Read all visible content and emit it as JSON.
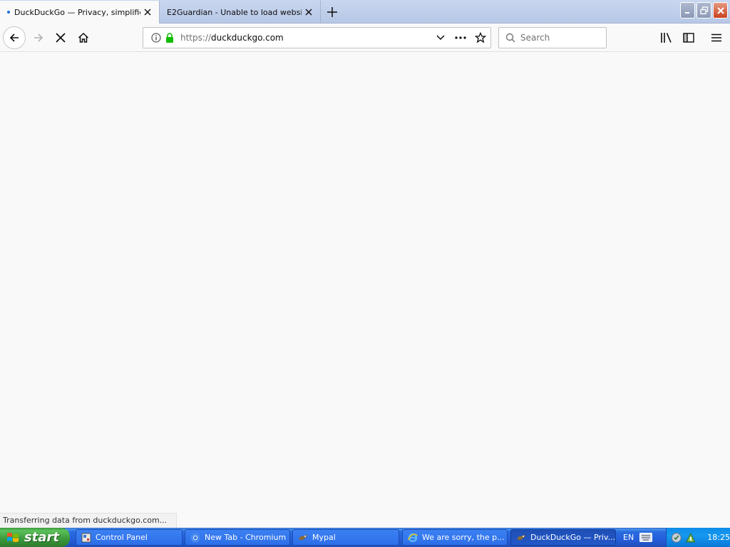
{
  "tabs": [
    {
      "title": "DuckDuckGo — Privacy, simplified.",
      "loading": true
    },
    {
      "title": "E2Guardian - Unable to load website"
    }
  ],
  "nav": {
    "url_scheme": "https://",
    "url_host": "duckduckgo.com"
  },
  "search": {
    "placeholder": "Search"
  },
  "status": {
    "text": "Transferring data from duckduckgo.com..."
  },
  "taskbar": {
    "start_label": "start",
    "items": [
      {
        "label": "Control Panel",
        "icon": "control-panel-icon"
      },
      {
        "label": "New Tab - Chromium",
        "icon": "chromium-icon"
      },
      {
        "label": "Mypal",
        "icon": "mypal-icon"
      },
      {
        "label": "We are sorry, the p...",
        "icon": "internet-explorer-icon"
      },
      {
        "label": "DuckDuckGo — Priv...",
        "icon": "mypal-icon",
        "active": true
      }
    ],
    "language": "EN",
    "clock": "18:25"
  },
  "colors": {
    "secure_lock": "#12bc00",
    "tab_loading_dot": "#1e6fd9",
    "taskbar_blue": "#245edb",
    "start_green": "#3a983a"
  }
}
